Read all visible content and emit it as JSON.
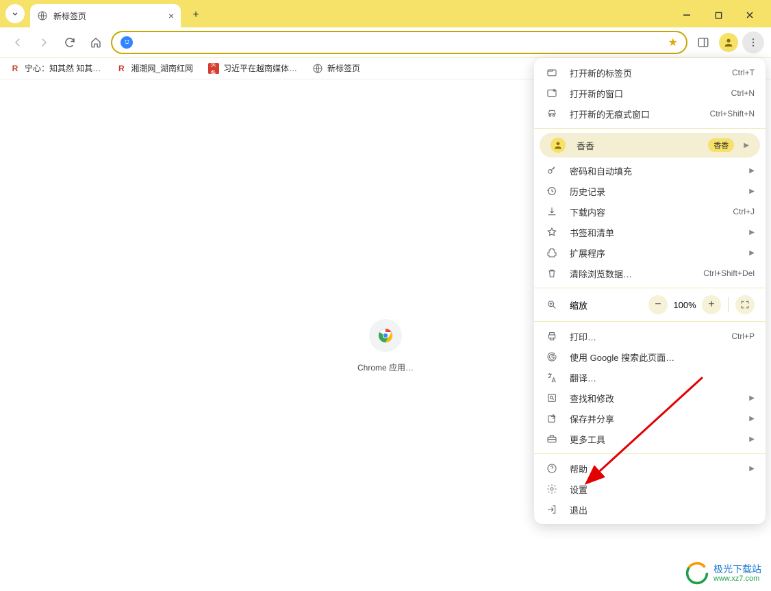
{
  "tab": {
    "title": "新标签页"
  },
  "bookmarks": [
    {
      "label": "宁心：知其然 知其…",
      "iconType": "red"
    },
    {
      "label": "湘潮网_湖南红网",
      "iconType": "red"
    },
    {
      "label": "习近平在越南媒体…",
      "iconType": "tag"
    },
    {
      "label": "新标签页",
      "iconType": "globe"
    }
  ],
  "shortcut": {
    "label": "Chrome 应用…"
  },
  "menu": {
    "new_tab": {
      "label": "打开新的标签页",
      "shortcut": "Ctrl+T"
    },
    "new_window": {
      "label": "打开新的窗口",
      "shortcut": "Ctrl+N"
    },
    "incognito": {
      "label": "打开新的无痕式窗口",
      "shortcut": "Ctrl+Shift+N"
    },
    "profile": {
      "label": "香香",
      "badge": "香香"
    },
    "passwords": {
      "label": "密码和自动填充"
    },
    "history": {
      "label": "历史记录"
    },
    "downloads": {
      "label": "下载内容",
      "shortcut": "Ctrl+J"
    },
    "bookmarks": {
      "label": "书签和清单"
    },
    "extensions": {
      "label": "扩展程序"
    },
    "clear_data": {
      "label": "清除浏览数据…",
      "shortcut": "Ctrl+Shift+Del"
    },
    "zoom": {
      "label": "缩放",
      "value": "100%"
    },
    "print": {
      "label": "打印…",
      "shortcut": "Ctrl+P"
    },
    "google_search": {
      "label": "使用 Google 搜索此页面…"
    },
    "translate": {
      "label": "翻译…"
    },
    "find": {
      "label": "查找和修改"
    },
    "save_share": {
      "label": "保存并分享"
    },
    "more_tools": {
      "label": "更多工具"
    },
    "help": {
      "label": "帮助"
    },
    "settings": {
      "label": "设置"
    },
    "exit": {
      "label": "退出"
    }
  },
  "watermark": {
    "name": "极光下载站",
    "url": "www.xz7.com"
  }
}
